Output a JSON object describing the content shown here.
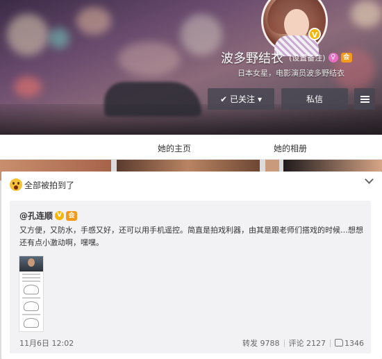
{
  "profile": {
    "name": "波多野结衣",
    "remark_label": "(设置备注)",
    "description": "日本女星，电影演员波多野结衣",
    "verified_badge": "V",
    "level_badge": "会"
  },
  "actions": {
    "follow_label": "已关注",
    "follow_arrow": "▾",
    "follow_check": "✔",
    "message_label": "私信"
  },
  "tabs": [
    {
      "label": "她的主页"
    },
    {
      "label": "她的相册"
    }
  ],
  "post": {
    "title": "全部被拍到了",
    "quote": {
      "author": "@孔连顺",
      "author_badge": "V",
      "text": "又方便，又防水，手感又好，还可以用手机遥控。简直是拍戏利器，由其是跟老师们搭戏的时候…想想还有点小激动啊，嘿嘿。",
      "date": "11月6日 12:02",
      "repost_label": "转发 9788",
      "comment_label": "评论 2127",
      "like_count": "1346"
    }
  },
  "colors": {
    "button_bg": "#505060",
    "vip_gold": "#f7b500",
    "quote_bg": "#f2f2f5"
  },
  "icons": [
    "checkmark-icon",
    "dropdown-caret-icon",
    "menu-icon",
    "emoji-icon",
    "chevron-down-icon",
    "thumbs-up-icon",
    "verified-icon"
  ]
}
